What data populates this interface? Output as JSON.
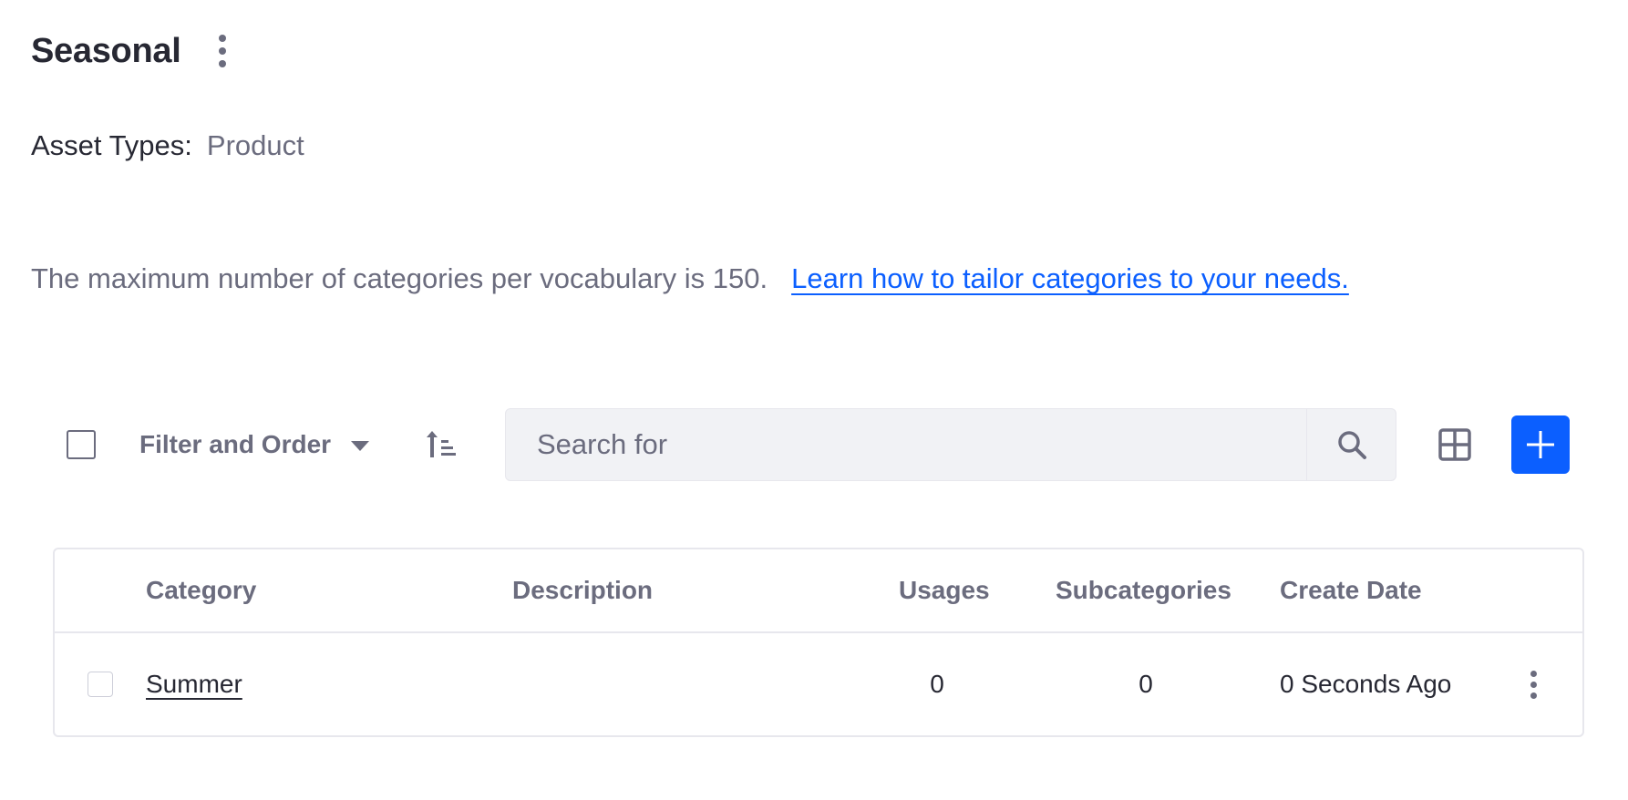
{
  "header": {
    "title": "Seasonal",
    "options_icon": "kebab-vertical-icon"
  },
  "asset_types": {
    "label": "Asset Types:",
    "value": "Product"
  },
  "info": {
    "text": "The maximum number of categories per vocabulary is 150.",
    "link": "Learn how to tailor categories to your needs."
  },
  "toolbar": {
    "filter_label": "Filter and Order",
    "search_placeholder": "Search for",
    "icons": [
      "caret-down-icon",
      "sort-ascending-icon",
      "search-icon",
      "grid-view-icon",
      "plus-icon"
    ],
    "accent_color": "#0b5fff"
  },
  "table": {
    "columns": [
      "Category",
      "Description",
      "Usages",
      "Subcategories",
      "Create Date"
    ],
    "rows": [
      {
        "category": "Summer",
        "description": "",
        "usages": "0",
        "subcategories": "0",
        "create_date": "0 Seconds Ago"
      }
    ]
  }
}
